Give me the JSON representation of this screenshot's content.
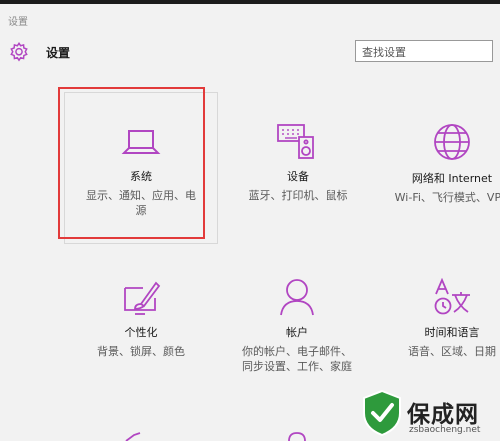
{
  "window": {
    "title": "设置"
  },
  "header": {
    "title": "设置",
    "search_placeholder": "查找设置"
  },
  "tiles": [
    {
      "name": "系统",
      "desc": [
        "显示、通知、应用、电",
        "源"
      ],
      "icon": "laptop-icon"
    },
    {
      "name": "设备",
      "desc": [
        "蓝牙、打印机、鼠标"
      ],
      "icon": "keyboard-speaker-icon"
    },
    {
      "name": "网络和 Internet",
      "desc": [
        "Wi-Fi、飞行模式、VPN"
      ],
      "icon": "globe-icon"
    },
    {
      "name": "个性化",
      "desc": [
        "背景、锁屏、颜色"
      ],
      "icon": "paint-brush-icon"
    },
    {
      "name": "帐户",
      "desc": [
        "你的帐户、电子邮件、",
        "同步设置、工作、家庭"
      ],
      "icon": "person-icon"
    },
    {
      "name": "时间和语言",
      "desc": [
        "语音、区域、日期"
      ],
      "icon": "time-language-icon"
    }
  ],
  "colors": {
    "accent": "#b146c2",
    "highlight": "#e23a3a",
    "background": "#f2f2f2"
  },
  "watermark": {
    "name": "保成网",
    "url": "zsbaocheng.net"
  }
}
